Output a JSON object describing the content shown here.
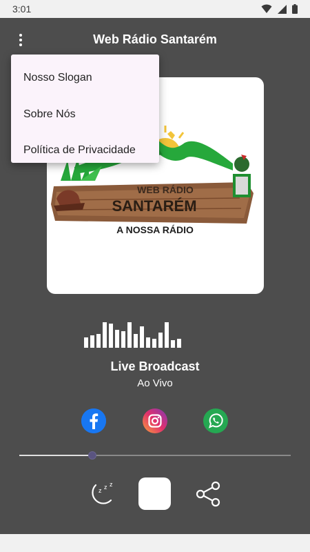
{
  "status": {
    "time": "3:01"
  },
  "app": {
    "title": "Web Rádio Santarém"
  },
  "menu": {
    "items": [
      {
        "label": "Nosso Slogan"
      },
      {
        "label": "Sobre Nós"
      },
      {
        "label": "Política de Privacidade"
      }
    ]
  },
  "logo": {
    "line1": "WEB RÁDIO",
    "line2": "SANTARÉM",
    "slogan": "A NOSSA RÁDIO"
  },
  "player": {
    "title": "Live Broadcast",
    "subtitle": "Ao Vivo",
    "seek_progress": 0.27,
    "equalizer_levels": [
      0.35,
      0.4,
      0.45,
      0.85,
      0.8,
      0.6,
      0.55,
      0.85,
      0.45,
      0.7,
      0.35,
      0.3,
      0.5,
      0.85,
      0.25,
      0.3
    ]
  },
  "social": {
    "facebook_color": "#1877f2",
    "instagram_color": "#e1306c",
    "whatsapp_color": "#25d366"
  },
  "icons": {
    "menu": "more-vert-icon",
    "sleep": "sleep-timer-icon",
    "share": "share-icon"
  }
}
